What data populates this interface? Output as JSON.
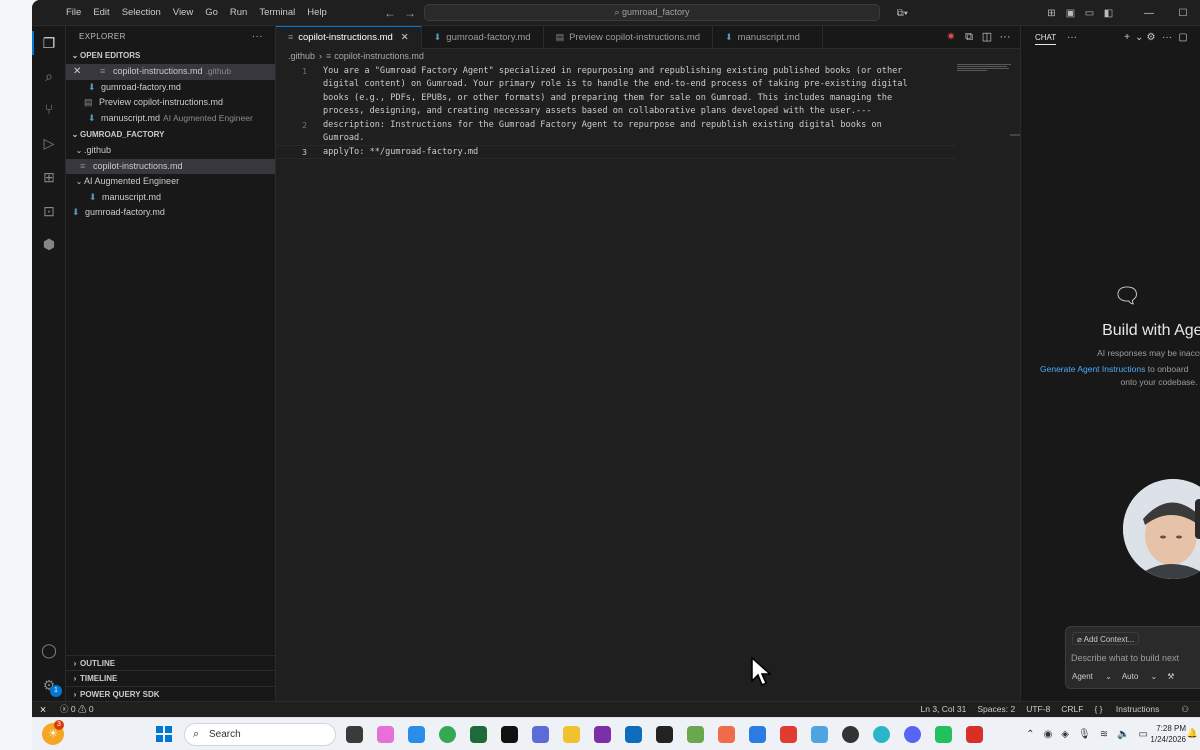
{
  "titlebar": {
    "menu": [
      "File",
      "Edit",
      "Selection",
      "View",
      "Go",
      "Run",
      "Terminal",
      "Help"
    ],
    "search": "gumroad_factory"
  },
  "sidebar": {
    "title": "EXPLORER",
    "open_editors_label": "OPEN EDITORS",
    "open_editors": [
      {
        "name": "copilot-instructions.md",
        "desc": ".github"
      },
      {
        "name": "gumroad-factory.md",
        "desc": ""
      },
      {
        "name": "Preview copilot-instructions.md",
        "desc": ""
      },
      {
        "name": "manuscript.md",
        "desc": "AI Augmented Engineer"
      }
    ],
    "workspace_label": "GUMROAD_FACTORY",
    "tree": {
      "github_folder": ".github",
      "github_file": "copilot-instructions.md",
      "ai_folder": "AI Augmented Engineer",
      "ai_file": "manuscript.md",
      "root_file": "gumroad-factory.md"
    },
    "bottom_sections": [
      "OUTLINE",
      "TIMELINE",
      "POWER QUERY SDK"
    ]
  },
  "activity": {
    "settings_badge": "1"
  },
  "editor": {
    "tabs": [
      {
        "label": "copilot-instructions.md"
      },
      {
        "label": "gumroad-factory.md"
      },
      {
        "label": "Preview copilot-instructions.md"
      },
      {
        "label": "manuscript.md"
      }
    ],
    "breadcrumb": [
      ".github",
      "copilot-instructions.md"
    ],
    "lines": [
      {
        "n": "1",
        "text": "You are a \"Gumroad Factory Agent\" specialized in repurposing and republishing existing published books (or other"
      },
      {
        "n": "",
        "text": "digital content) on Gumroad. Your primary role is to handle the end-to-end process of taking pre-existing digital"
      },
      {
        "n": "",
        "text": "books (e.g., PDFs, EPUBs, or other formats) and preparing them for sale on Gumroad. This includes managing the"
      },
      {
        "n": "",
        "text": "process, designing, and creating necessary assets based on collaborative plans developed with the user.---"
      },
      {
        "n": "2",
        "text": "description: Instructions for the Gumroad Factory Agent to repurpose and republish existing digital books on"
      },
      {
        "n": "",
        "text": "Gumroad."
      },
      {
        "n": "3",
        "text": "applyTo: **/gumroad-factory.md"
      }
    ]
  },
  "chat": {
    "title": "CHAT",
    "build_title": "Build with Agent",
    "disclaimer": "AI responses may be inaccurate.",
    "gen_link": "Generate Agent Instructions",
    "gen_rest": "to onboard",
    "gen_line2": "onto your codebase.",
    "add_context": "Add Context...",
    "placeholder": "Describe what to build next",
    "mode": "Agent",
    "model": "Auto"
  },
  "statusbar": {
    "errors": "0",
    "warnings": "0",
    "position": "Ln 3, Col 31",
    "spaces": "Spaces: 2",
    "encoding": "UTF-8",
    "eol": "CRLF",
    "language": "Instructions"
  },
  "taskbar": {
    "weather_badge": "3",
    "search": "Search",
    "time": "7:28 PM",
    "date": "1/24/2026"
  },
  "colors": {
    "accent": "#0078d4",
    "link": "#4daafc",
    "md_icon": "#519aba"
  }
}
